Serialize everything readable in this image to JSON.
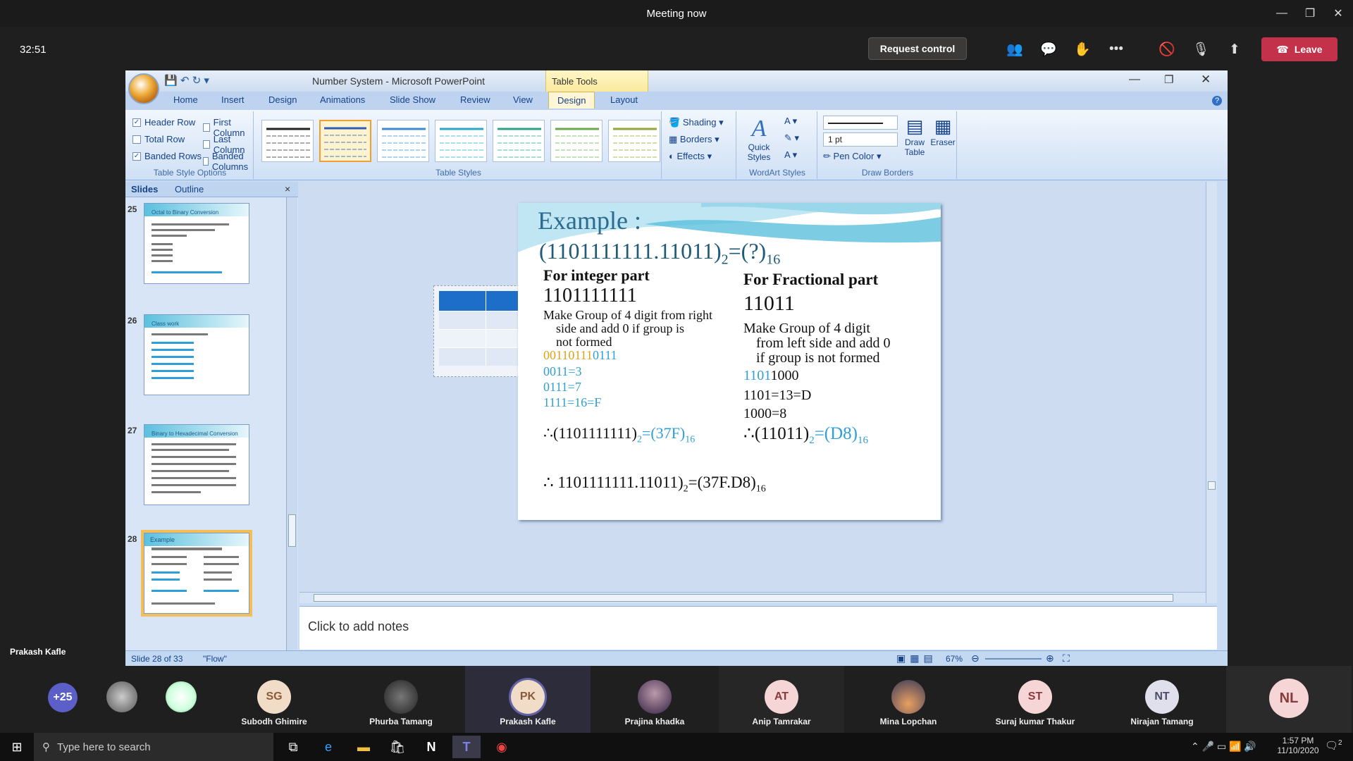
{
  "window": {
    "title": "Meeting now"
  },
  "meeting": {
    "timer": "32:51",
    "request_control": "Request control",
    "leave": "Leave",
    "presenter_label": "Prakash Kafle"
  },
  "ppt": {
    "title": "Number System - Microsoft PowerPoint",
    "context_tab": "Table Tools",
    "tabs": [
      "Home",
      "Insert",
      "Design",
      "Animations",
      "Slide Show",
      "Review",
      "View",
      "Design",
      "Layout"
    ],
    "table_style_options": {
      "options": [
        {
          "label": "Header Row",
          "checked": true
        },
        {
          "label": "First Column",
          "checked": false
        },
        {
          "label": "Total Row",
          "checked": false
        },
        {
          "label": "Last Column",
          "checked": false
        },
        {
          "label": "Banded Rows",
          "checked": true
        },
        {
          "label": "Banded Columns",
          "checked": false
        }
      ],
      "group_label": "Table Style Options"
    },
    "table_styles": {
      "group_label": "Table Styles",
      "shading": "Shading",
      "borders": "Borders",
      "effects": "Effects"
    },
    "wordart": {
      "quick_styles": "Quick Styles",
      "group_label": "WordArt Styles"
    },
    "draw_borders": {
      "pen_weight": "1 pt",
      "pen_color": "Pen Color",
      "draw_table": "Draw Table",
      "eraser": "Eraser",
      "group_label": "Draw Borders"
    },
    "panel": {
      "tab_slides": "Slides",
      "tab_outline": "Outline",
      "close": "×"
    },
    "thumbs": [
      {
        "num": "25",
        "title": "Octal to Binary Conversion"
      },
      {
        "num": "26",
        "title": "Class work"
      },
      {
        "num": "27",
        "title": "Binary to Hexadecimal Conversion"
      },
      {
        "num": "28",
        "title": "Example"
      }
    ],
    "notes_placeholder": "Click to add notes",
    "status": {
      "slide": "Slide 28 of 33",
      "theme": "\"Flow\"",
      "zoom": "67%"
    }
  },
  "slide": {
    "title": "Example :",
    "equation_base": "(1101111111.11011)",
    "equation_sub": "2",
    "equation_rhs": "=(?)",
    "equation_rhs_sub": "16",
    "left": {
      "heading": "For  integer part",
      "number": "1101111111",
      "rule": [
        "Make Group of 4 digit from right",
        "side and add 0  if group is",
        "not formed"
      ],
      "grouped_a": "0011",
      "grouped_b": "0111",
      "grouped_c": "0111",
      "lines": [
        "0011=3",
        "0111=7",
        "1111=16=F"
      ],
      "result_pre": "∴(1101111111)",
      "result_sub": "2",
      "result_mid": "=(37F)",
      "result_sub2": "16"
    },
    "right": {
      "heading": "For Fractional part",
      "number": "11011",
      "rule": [
        "Make  Group  of 4 digit",
        "from left side  and add  0",
        "if group is   not formed"
      ],
      "padded_a": "1101",
      "padded_b": "1000",
      "lines": [
        "1101=13=D",
        "1000=8"
      ],
      "result_pre": "∴(11011)",
      "result_sub": "2",
      "result_mid": "=(D8)",
      "result_sub2": "16"
    },
    "final_pre": "∴ 1101111111.11011)",
    "final_sub": "2",
    "final_mid": "=(37F.D8)",
    "final_sub2": "16"
  },
  "participants": {
    "overflow": "+25",
    "people": [
      {
        "initials": "SG",
        "name": "Subodh Ghimire"
      },
      {
        "initials": "",
        "name": "Phurba Tamang"
      },
      {
        "initials": "PK",
        "name": "Prakash Kafle"
      },
      {
        "initials": "",
        "name": "Prajina khadka"
      },
      {
        "initials": "AT",
        "name": "Anip Tamrakar"
      },
      {
        "initials": "",
        "name": "Mina Lopchan"
      },
      {
        "initials": "ST",
        "name": "Suraj kumar Thakur"
      },
      {
        "initials": "NT",
        "name": "Nirajan Tamang"
      },
      {
        "initials": "NL",
        "name": ""
      }
    ]
  },
  "taskbar": {
    "search_placeholder": "Type here to search",
    "time": "1:57 PM",
    "date": "11/10/2020",
    "notif_count": "2"
  },
  "colors": {
    "accent_blue": "#2e9fd8",
    "highlight_orange": "#e0a21a",
    "leave_red": "#c4314b"
  }
}
